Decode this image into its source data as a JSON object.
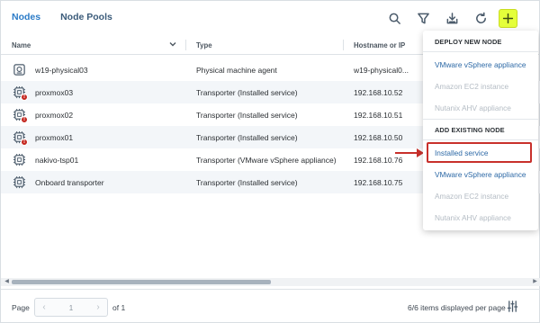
{
  "tabs": [
    {
      "label": "Nodes",
      "active": true
    },
    {
      "label": "Node Pools",
      "active": false
    }
  ],
  "toolbar": {
    "icons": [
      "search-icon",
      "filter-icon",
      "download-icon",
      "refresh-icon",
      "add-icon"
    ],
    "add_accent": "#e5ff3a"
  },
  "table": {
    "columns": [
      "Name",
      "Type",
      "Hostname or IP"
    ],
    "rows": [
      {
        "name": "w19-physical03",
        "type": "Physical machine agent",
        "host": "w19-physical0...",
        "icon": "physical-machine-icon",
        "error": false
      },
      {
        "name": "proxmox03",
        "type": "Transporter (Installed service)",
        "host": "192.168.10.52",
        "icon": "transporter-icon",
        "error": true
      },
      {
        "name": "proxmox02",
        "type": "Transporter (Installed service)",
        "host": "192.168.10.51",
        "icon": "transporter-icon",
        "error": true
      },
      {
        "name": "proxmox01",
        "type": "Transporter (Installed service)",
        "host": "192.168.10.50",
        "icon": "transporter-icon",
        "error": true
      },
      {
        "name": "nakivo-tsp01",
        "type": "Transporter (VMware vSphere appliance)",
        "host": "192.168.10.76",
        "icon": "transporter-icon",
        "error": false
      },
      {
        "name": "Onboard transporter",
        "type": "Transporter (Installed service)",
        "host": "192.168.10.75",
        "icon": "transporter-icon",
        "error": false
      }
    ],
    "error_badge": "!"
  },
  "footer": {
    "page_label": "Page",
    "page_value": "1",
    "of_label": "of 1",
    "items_label": "6/6 items displayed per page"
  },
  "dropdown": {
    "deploy_header": "DEPLOY NEW NODE",
    "deploy_items": [
      {
        "label": "VMware vSphere appliance",
        "enabled": true
      },
      {
        "label": "Amazon EC2 instance",
        "enabled": false
      },
      {
        "label": "Nutanix AHV appliance",
        "enabled": false
      }
    ],
    "existing_header": "ADD EXISTING NODE",
    "existing_items": [
      {
        "label": "Installed service",
        "enabled": true,
        "highlighted": true
      },
      {
        "label": "VMware vSphere appliance",
        "enabled": true
      },
      {
        "label": "Amazon EC2 instance",
        "enabled": false
      },
      {
        "label": "Nutanix AHV appliance",
        "enabled": false
      }
    ]
  },
  "colors": {
    "active_tab": "#2b7bc7",
    "error": "#c4271f",
    "callout": "#c8302b",
    "link": "#2d69a6",
    "disabled": "#b4bcc4"
  }
}
